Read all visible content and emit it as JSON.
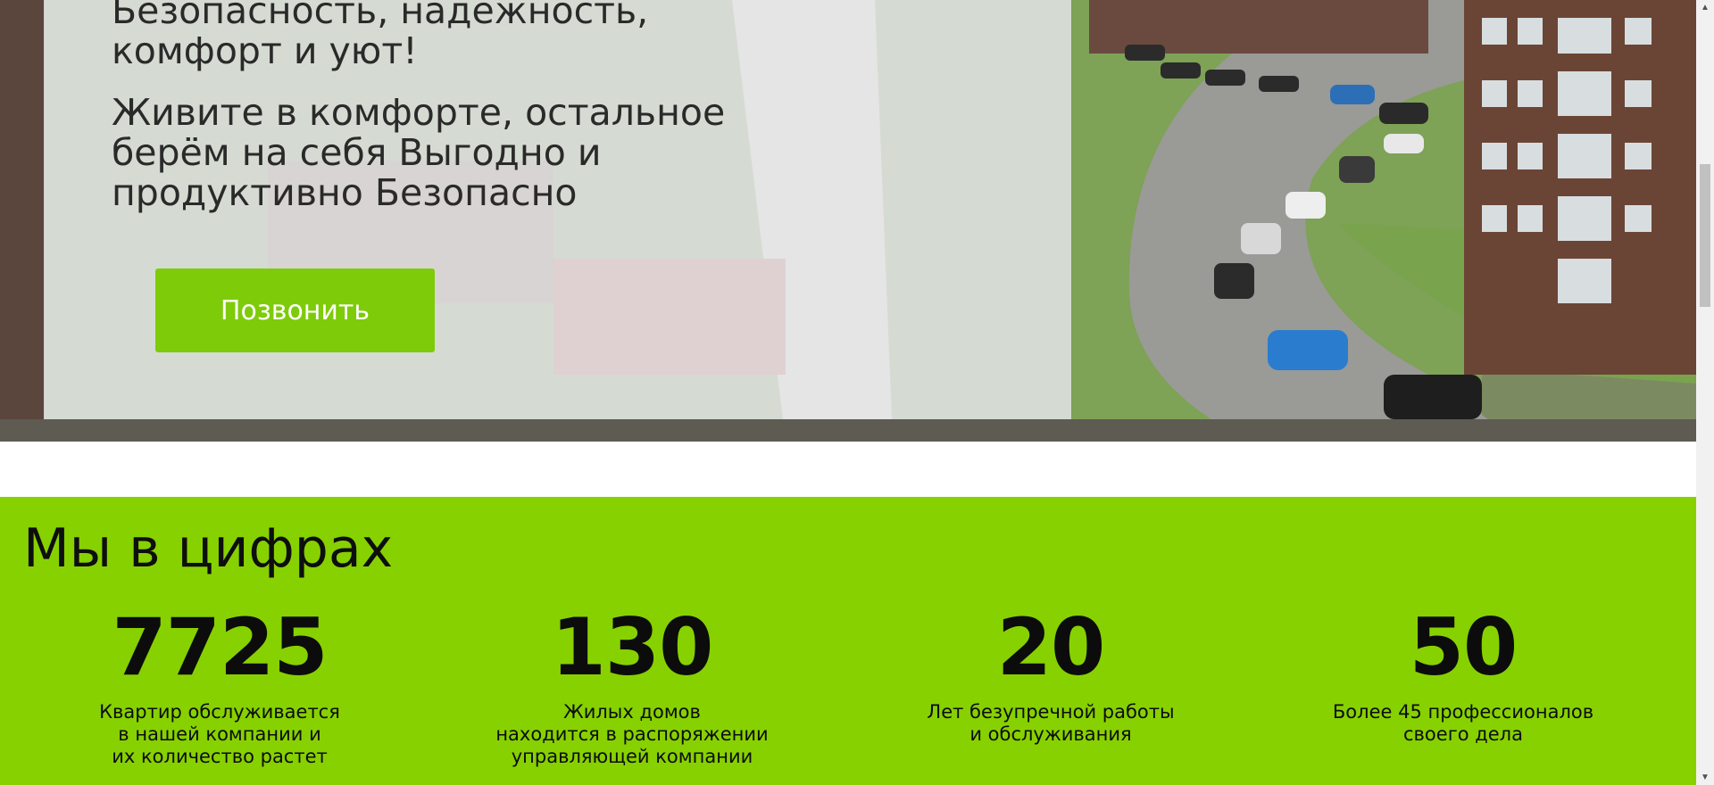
{
  "hero": {
    "line1": "Безопасность, надёжность, комфорт и уют!",
    "line2": "Живите в комфорте, остальное берём на себя Выгодно и продуктивно Безопасно",
    "call_button_label": "Позвонить",
    "button_color": "#7ecb0a"
  },
  "stats": {
    "title": "Мы в цифрах",
    "background_color": "#87d100",
    "items": [
      {
        "number": "7725",
        "description": "Квартир обслуживается\nв нашей компании и\nих количество растет"
      },
      {
        "number": "130",
        "description": "Жилых домов\nнаходится в распоряжении\nуправляющей компании"
      },
      {
        "number": "20",
        "description": "Лет безупречной работы\nи обслуживания"
      },
      {
        "number": "50",
        "description": "Более 45 профессионалов\nсвоего дела"
      }
    ]
  },
  "icons": {
    "scroll_up": "chevron-up-icon",
    "scroll_down": "chevron-down-icon"
  }
}
